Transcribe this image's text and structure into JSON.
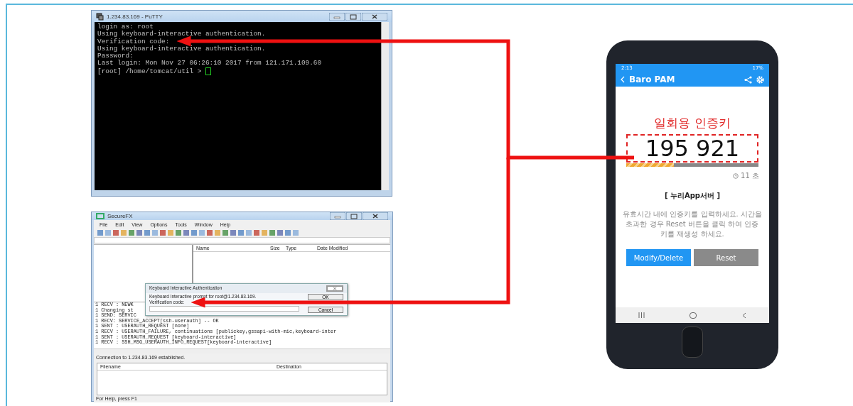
{
  "putty": {
    "title": "1.234.83.169 - PuTTY",
    "lines": [
      "login as: root",
      "Using keyboard-interactive authentication.",
      "Verification code:",
      "Using keyboard-interactive authentication.",
      "Password:",
      "Last login: Mon Nov 27 06:26:10 2017 from 121.171.109.60"
    ],
    "prompt": "[root] /home/tomcat/util > "
  },
  "securefx": {
    "title": "SecureFX",
    "menu": [
      "File",
      "Edit",
      "View",
      "Options",
      "Tools",
      "Window",
      "Help"
    ],
    "file_columns": [
      "Name",
      "Size",
      "Type",
      "Date Modified"
    ],
    "log_lines": [
      "1 RECV : NEWK",
      "1 Changing st",
      "1 SEND: SERVIC",
      "1 RECV: SERVICE_ACCEPT[ssh-userauth] -- OK",
      "1 SENT : USERAUTH_REQUEST [none]",
      "1 RECV : USERAUTH_FAILURE, continuations [publickey,gssapi-with-mic,keyboard-inter",
      "1 SENT : USERAUTH_REQUEST [keyboard-interactive]",
      "1 RECV : SSH_MSG_USERAUTH_INFO_REQUEST[keyboard-interactive]"
    ],
    "status_message": "Connection to 1.234.83.169 established.",
    "transfer_columns": [
      "Filename",
      "Destination"
    ],
    "status_bar": "For Help, press F1",
    "dialog": {
      "title": "Keyboard Interactive Authentication",
      "prompt": "Keyboard Interactive prompt for root@1.234.83.169.",
      "label": "Verification code:",
      "buttons": [
        "OK",
        "Cancel"
      ]
    }
  },
  "phone": {
    "time": "2:13",
    "battery": "17%",
    "app_title": "Baro PAM",
    "heading": "일회용 인증키",
    "code": "195 921",
    "timer": {
      "level": 0.36,
      "remaining": "11 초"
    },
    "server": "[ 누리App서버 ]",
    "message": "유효시간 내에 인증키를 입력하세요. 시간을 초과한 경우 Reset 버튼을 클릭 하여 인증키를 재생성 하세요.",
    "buttons": [
      "Modify/Delete",
      "Reset"
    ]
  }
}
